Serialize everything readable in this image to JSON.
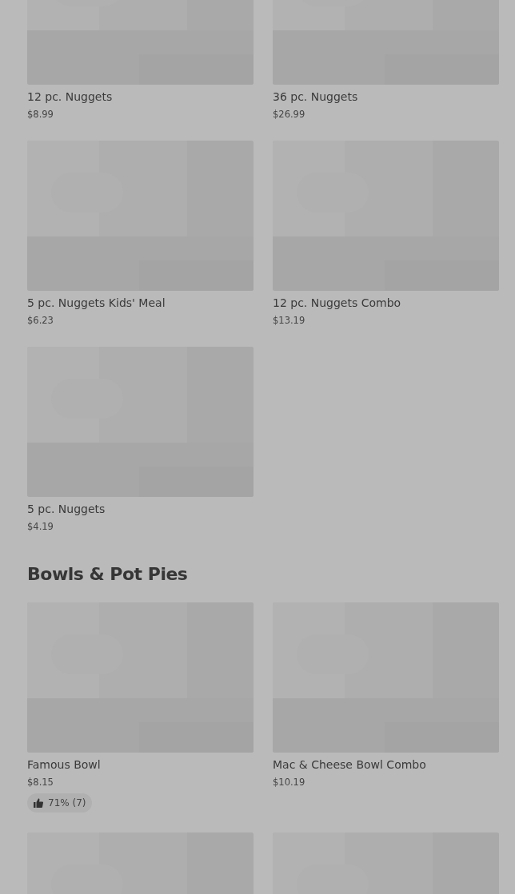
{
  "sections": [
    {
      "items": [
        {
          "kind": "picture",
          "name": "12 pc. Nuggets",
          "price": "$8.99"
        },
        {
          "kind": "picture",
          "name": "36 pc. Nuggets",
          "price": "$26.99"
        },
        {
          "kind": "picture",
          "name": "5 pc. Nuggets Kids' Meal",
          "price": "$6.23"
        },
        {
          "kind": "picture",
          "name": "12 pc. Nuggets Combo",
          "price": "$13.19"
        },
        {
          "kind": "picture",
          "name": "5 pc. Nuggets",
          "price": "$4.19"
        }
      ]
    },
    {
      "title": "Bowls & Pot Pies",
      "items": [
        {
          "kind": "picture",
          "name": "Famous Bowl",
          "price": "$8.15",
          "rating": "71% (7)"
        },
        {
          "kind": "picture",
          "name": "Mac & Cheese Bowl Combo",
          "price": "$10.19"
        },
        {
          "kind": "picture"
        },
        {
          "kind": "picture"
        }
      ]
    }
  ]
}
